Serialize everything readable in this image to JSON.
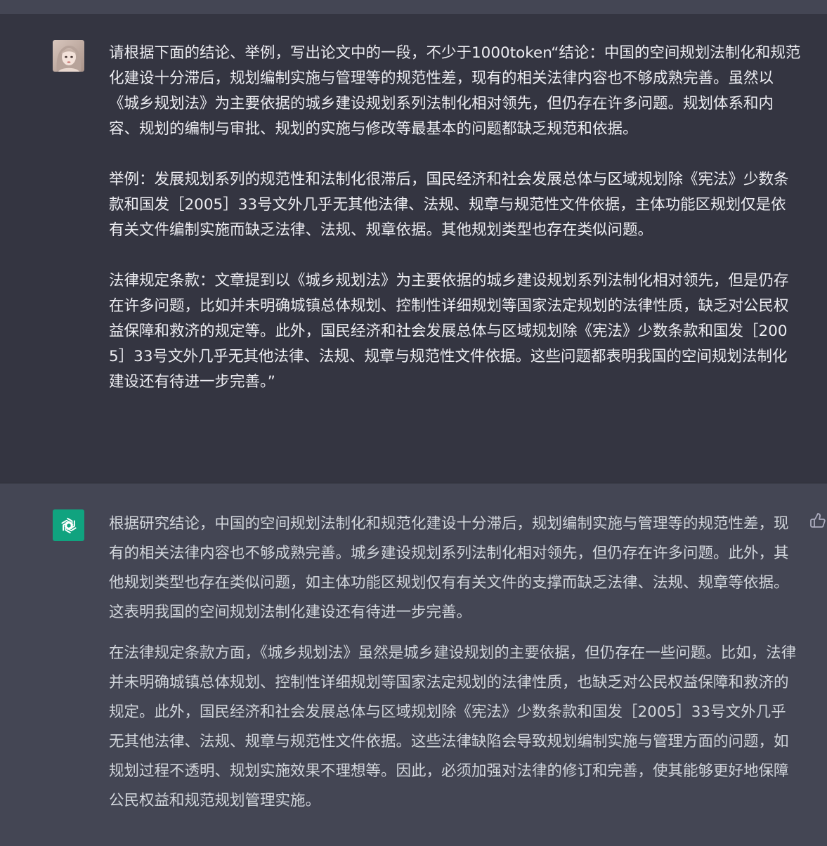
{
  "conversation": {
    "user_message": {
      "paragraphs": [
        "请根据下面的结论、举例，写出论文中的一段，不少于1000token“结论：中国的空间规划法制化和规范化建设十分滞后，规划编制实施与管理等的规范性差，现有的相关法律内容也不够成熟完善。虽然以《城乡规划法》为主要依据的城乡建设规划系列法制化相对领先，但仍存在许多问题。规划体系和内容、规划的编制与审批、规划的实施与修改等最基本的问题都缺乏规范和依据。",
        "举例：发展规划系列的规范性和法制化很滞后，国民经济和社会发展总体与区域规划除《宪法》少数条款和国发［2005］33号文外几乎无其他法律、法规、规章与规范性文件依据，主体功能区规划仅是依有关文件编制实施而缺乏法律、法规、规章依据。其他规划类型也存在类似问题。",
        "法律规定条款：文章提到以《城乡规划法》为主要依据的城乡建设规划系列法制化相对领先，但是仍存在许多问题，比如并未明确城镇总体规划、控制性详细规划等国家法定规划的法律性质，缺乏对公民权益保障和救济的规定等。此外，国民经济和社会发展总体与区域规划除《宪法》少数条款和国发［2005］33号文外几乎无其他法律、法规、规章与规范性文件依据。这些问题都表明我国的空间规划法制化建设还有待进一步完善。”"
      ]
    },
    "assistant_message": {
      "paragraphs": [
        "根据研究结论，中国的空间规划法制化和规范化建设十分滞后，规划编制实施与管理等的规范性差，现有的相关法律内容也不够成熟完善。城乡建设规划系列法制化相对领先，但仍存在许多问题。此外，其他规划类型也存在类似问题，如主体功能区规划仅有有关文件的支撑而缺乏法律、法规、规章等依据。这表明我国的空间规划法制化建设还有待进一步完善。",
        "在法律规定条款方面，《城乡规划法》虽然是城乡建设规划的主要依据，但仍存在一些问题。比如，法律并未明确城镇总体规划、控制性详细规划等国家法定规划的法律性质，也缺乏对公民权益保障和救济的规定。此外，国民经济和社会发展总体与区域规划除《宪法》少数条款和国发［2005］33号文外几乎无其他法律、法规、规章与规范性文件依据。这些法律缺陷会导致规划编制实施与管理方面的问题，如规划过程不透明、规划实施效果不理想等。因此，必须加强对法律的修订和完善，使其能够更好地保障公民权益和规范规划管理实施。"
      ]
    }
  },
  "icons": {
    "user_avatar": "user-avatar-photo",
    "assistant_avatar": "openai-logo-icon",
    "feedback": "thumbs-up-icon"
  },
  "colors": {
    "user_bg": "#343541",
    "assistant_bg": "#444654",
    "brand_green": "#10a37f",
    "user_text": "#ececf1",
    "assistant_text": "#d1d5db"
  }
}
